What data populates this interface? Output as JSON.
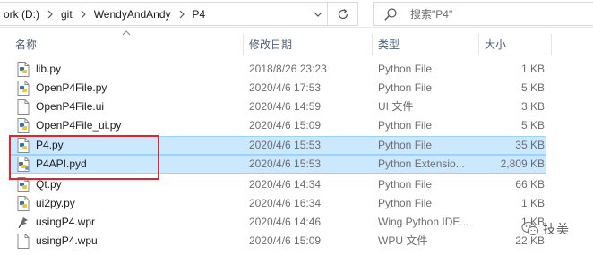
{
  "address_bar": {
    "crumbs": [
      "ork (D:)",
      "git",
      "WendyAndAndy",
      "P4"
    ]
  },
  "search": {
    "placeholder": "搜索\"P4\""
  },
  "columns": {
    "name": "名称",
    "date": "修改日期",
    "type": "类型",
    "size": "大小"
  },
  "files": [
    {
      "name": "lib.py",
      "date": "2018/8/26 23:23",
      "type": "Python File",
      "size": "1 KB",
      "icon": "python-file-icon",
      "selected": false
    },
    {
      "name": "OpenP4File.py",
      "date": "2020/4/6 17:53",
      "type": "Python File",
      "size": "5 KB",
      "icon": "python-file-icon",
      "selected": false
    },
    {
      "name": "OpenP4File.ui",
      "date": "2020/4/6 14:59",
      "type": "UI 文件",
      "size": "3 KB",
      "icon": "blank-file-icon",
      "selected": false
    },
    {
      "name": "OpenP4File_ui.py",
      "date": "2020/4/6 15:09",
      "type": "Python File",
      "size": "5 KB",
      "icon": "python-file-icon",
      "selected": false
    },
    {
      "name": "P4.py",
      "date": "2020/4/6 15:53",
      "type": "Python File",
      "size": "35 KB",
      "icon": "python-file-icon",
      "selected": true
    },
    {
      "name": "P4API.pyd",
      "date": "2020/4/6 15:53",
      "type": "Python Extensio...",
      "size": "2,809 KB",
      "icon": "python-ext-file-icon",
      "selected": true
    },
    {
      "name": "Qt.py",
      "date": "2020/4/6 14:34",
      "type": "Python File",
      "size": "66 KB",
      "icon": "python-file-icon",
      "selected": false
    },
    {
      "name": "ui2py.py",
      "date": "2020/4/6 16:34",
      "type": "Python File",
      "size": "1 KB",
      "icon": "python-file-icon",
      "selected": false
    },
    {
      "name": "usingP4.wpr",
      "date": "2020/4/6 14:46",
      "type": "Wing Python IDE...",
      "size": "1 KB",
      "icon": "wing-file-icon",
      "selected": false
    },
    {
      "name": "usingP4.wpu",
      "date": "2020/4/6 15:09",
      "type": "WPU 文件",
      "size": "22 KB",
      "icon": "blank-file-icon",
      "selected": false
    }
  ],
  "watermark": {
    "text": "技美"
  },
  "colors": {
    "selection": "#cce8ff",
    "selection_border": "#99d1ff",
    "annotation": "#e0262b",
    "header_text": "#4c607a"
  }
}
